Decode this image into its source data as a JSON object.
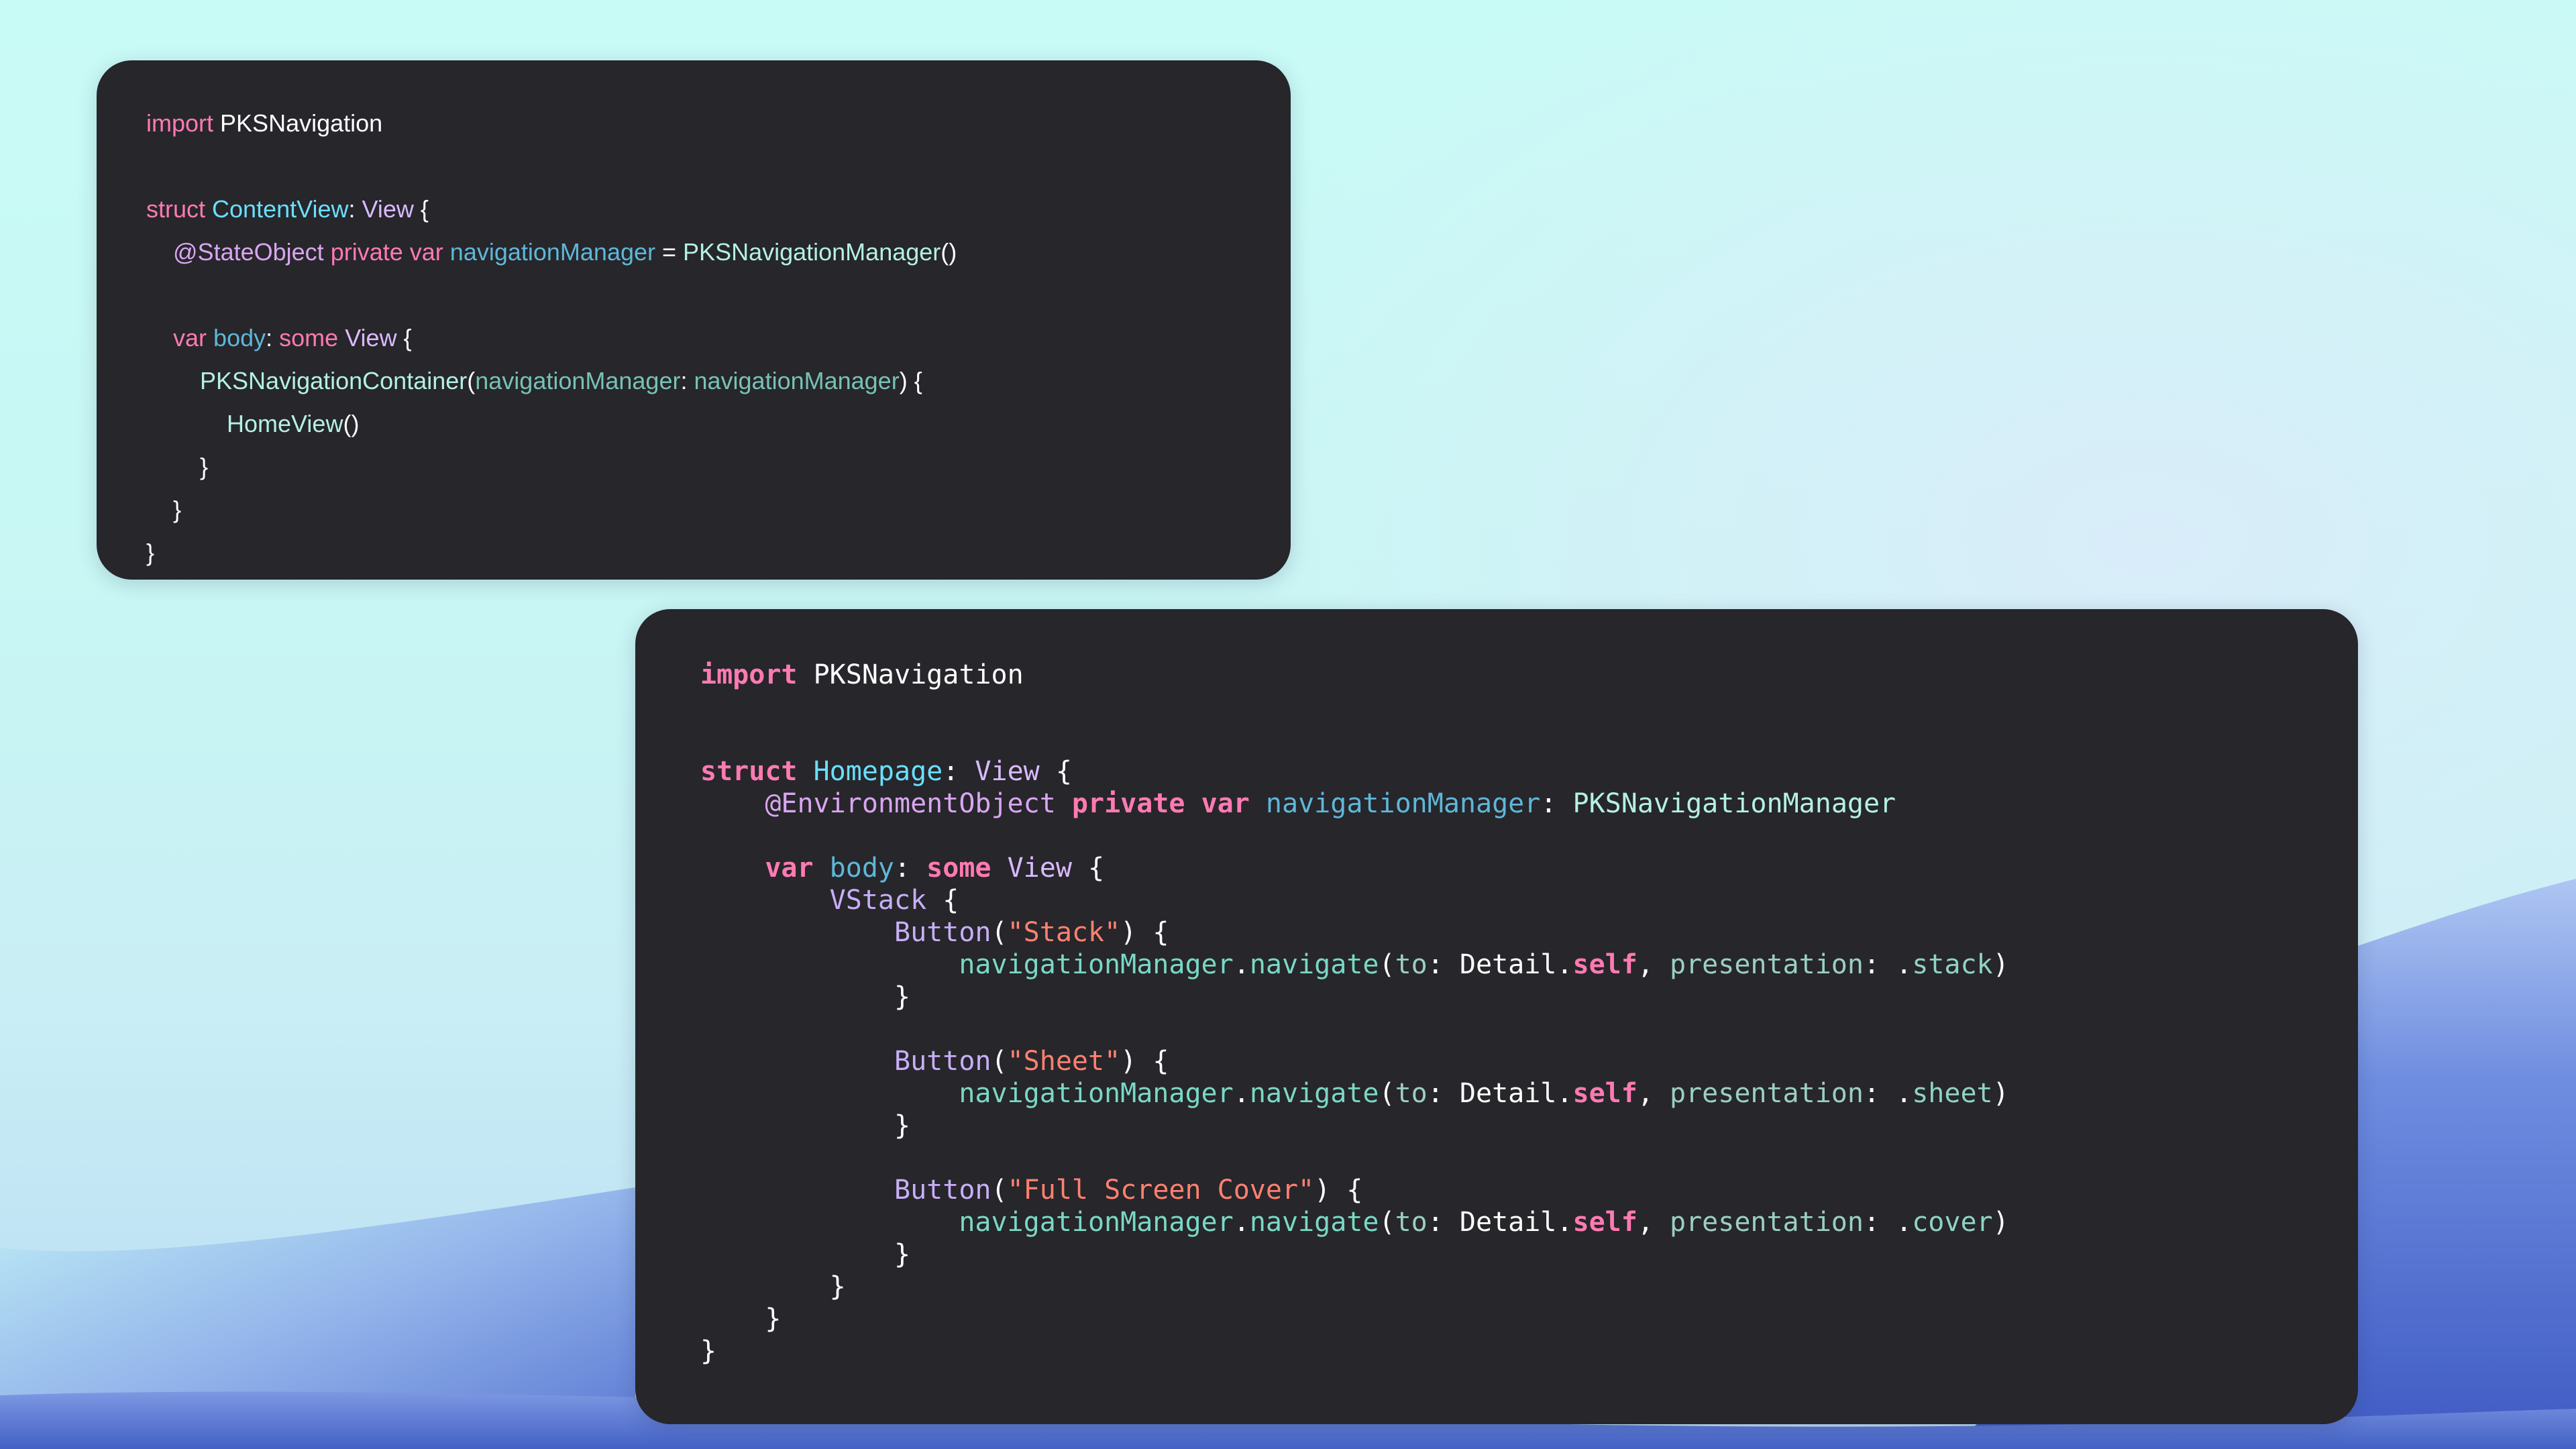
{
  "colors": {
    "card_background": "#26262b",
    "keyword": "#ff7ab2",
    "type_declaration": "#6bdfff",
    "type_reference": "#dabaff",
    "string": "#ff8170",
    "property": "#5fb7d8",
    "plain": "#ffffff",
    "background_top": "#c9fbf6",
    "wave_blue": "#4d6ad0"
  },
  "snippets": [
    {
      "lines": [
        [
          {
            "k": "keyword",
            "t": "import"
          },
          {
            "k": "plain",
            "t": " PKSNavigation"
          }
        ],
        [],
        [
          {
            "k": "keyword",
            "t": "struct"
          },
          {
            "k": "plain",
            "t": " "
          },
          {
            "k": "type",
            "t": "ContentView"
          },
          {
            "k": "plain",
            "t": ": "
          },
          {
            "k": "typeref",
            "t": "View"
          },
          {
            "k": "plain",
            "t": " {"
          }
        ],
        [
          {
            "k": "plain",
            "t": "    "
          },
          {
            "k": "attr",
            "t": "@StateObject"
          },
          {
            "k": "plain",
            "t": " "
          },
          {
            "k": "keyword",
            "t": "private"
          },
          {
            "k": "plain",
            "t": " "
          },
          {
            "k": "keyword",
            "t": "var"
          },
          {
            "k": "plain",
            "t": " "
          },
          {
            "k": "prop",
            "t": "navigationManager"
          },
          {
            "k": "plain",
            "t": " = "
          },
          {
            "k": "call",
            "t": "PKSNavigationManager"
          },
          {
            "k": "plain",
            "t": "()"
          }
        ],
        [],
        [
          {
            "k": "plain",
            "t": "    "
          },
          {
            "k": "keyword",
            "t": "var"
          },
          {
            "k": "plain",
            "t": " "
          },
          {
            "k": "prop",
            "t": "body"
          },
          {
            "k": "plain",
            "t": ": "
          },
          {
            "k": "keyword",
            "t": "some"
          },
          {
            "k": "plain",
            "t": " "
          },
          {
            "k": "typeref",
            "t": "View"
          },
          {
            "k": "plain",
            "t": " {"
          }
        ],
        [
          {
            "k": "plain",
            "t": "        "
          },
          {
            "k": "call",
            "t": "PKSNavigationContainer"
          },
          {
            "k": "plain",
            "t": "("
          },
          {
            "k": "arg",
            "t": "navigationManager"
          },
          {
            "k": "plain",
            "t": ": "
          },
          {
            "k": "arg",
            "t": "navigationManager"
          },
          {
            "k": "plain",
            "t": ") {"
          }
        ],
        [
          {
            "k": "plain",
            "t": "            "
          },
          {
            "k": "call",
            "t": "HomeView"
          },
          {
            "k": "plain",
            "t": "()"
          }
        ],
        [
          {
            "k": "plain",
            "t": "        }"
          }
        ],
        [
          {
            "k": "plain",
            "t": "    }"
          }
        ],
        [
          {
            "k": "plain",
            "t": "}"
          }
        ]
      ]
    },
    {
      "lines": [
        [
          {
            "k": "keyword",
            "t": "import"
          },
          {
            "k": "plain",
            "t": " PKSNavigation"
          }
        ],
        [],
        [],
        [
          {
            "k": "keyword",
            "t": "struct"
          },
          {
            "k": "plain",
            "t": " "
          },
          {
            "k": "type",
            "t": "Homepage"
          },
          {
            "k": "plain",
            "t": ": "
          },
          {
            "k": "typeref",
            "t": "View"
          },
          {
            "k": "plain",
            "t": " {"
          }
        ],
        [
          {
            "k": "plain",
            "t": "    "
          },
          {
            "k": "attr",
            "t": "@EnvironmentObject"
          },
          {
            "k": "plain",
            "t": " "
          },
          {
            "k": "keyword",
            "t": "private"
          },
          {
            "k": "plain",
            "t": " "
          },
          {
            "k": "keyword",
            "t": "var"
          },
          {
            "k": "plain",
            "t": " "
          },
          {
            "k": "prop",
            "t": "navigationManager"
          },
          {
            "k": "plain",
            "t": ": "
          },
          {
            "k": "call",
            "t": "PKSNavigationManager"
          }
        ],
        [],
        [
          {
            "k": "plain",
            "t": "    "
          },
          {
            "k": "keyword",
            "t": "var"
          },
          {
            "k": "plain",
            "t": " "
          },
          {
            "k": "prop",
            "t": "body"
          },
          {
            "k": "plain",
            "t": ": "
          },
          {
            "k": "keyword",
            "t": "some"
          },
          {
            "k": "plain",
            "t": " "
          },
          {
            "k": "typeref",
            "t": "View"
          },
          {
            "k": "plain",
            "t": " {"
          }
        ],
        [
          {
            "k": "plain",
            "t": "        "
          },
          {
            "k": "func",
            "t": "VStack"
          },
          {
            "k": "plain",
            "t": " {"
          }
        ],
        [
          {
            "k": "plain",
            "t": "            "
          },
          {
            "k": "func",
            "t": "Button"
          },
          {
            "k": "plain",
            "t": "("
          },
          {
            "k": "string",
            "t": "\"Stack\""
          },
          {
            "k": "plain",
            "t": ") {"
          }
        ],
        [
          {
            "k": "plain",
            "t": "                "
          },
          {
            "k": "method",
            "t": "navigationManager"
          },
          {
            "k": "plain",
            "t": "."
          },
          {
            "k": "method",
            "t": "navigate"
          },
          {
            "k": "plain",
            "t": "("
          },
          {
            "k": "label",
            "t": "to"
          },
          {
            "k": "plain",
            "t": ": Detail."
          },
          {
            "k": "keyword",
            "t": "self"
          },
          {
            "k": "plain",
            "t": ", "
          },
          {
            "k": "label",
            "t": "presentation"
          },
          {
            "k": "plain",
            "t": ": ."
          },
          {
            "k": "case",
            "t": "stack"
          },
          {
            "k": "plain",
            "t": ")"
          }
        ],
        [
          {
            "k": "plain",
            "t": "            }"
          }
        ],
        [],
        [
          {
            "k": "plain",
            "t": "            "
          },
          {
            "k": "func",
            "t": "Button"
          },
          {
            "k": "plain",
            "t": "("
          },
          {
            "k": "string",
            "t": "\"Sheet\""
          },
          {
            "k": "plain",
            "t": ") {"
          }
        ],
        [
          {
            "k": "plain",
            "t": "                "
          },
          {
            "k": "method",
            "t": "navigationManager"
          },
          {
            "k": "plain",
            "t": "."
          },
          {
            "k": "method",
            "t": "navigate"
          },
          {
            "k": "plain",
            "t": "("
          },
          {
            "k": "label",
            "t": "to"
          },
          {
            "k": "plain",
            "t": ": Detail."
          },
          {
            "k": "keyword",
            "t": "self"
          },
          {
            "k": "plain",
            "t": ", "
          },
          {
            "k": "label",
            "t": "presentation"
          },
          {
            "k": "plain",
            "t": ": ."
          },
          {
            "k": "case",
            "t": "sheet"
          },
          {
            "k": "plain",
            "t": ")"
          }
        ],
        [
          {
            "k": "plain",
            "t": "            }"
          }
        ],
        [],
        [
          {
            "k": "plain",
            "t": "            "
          },
          {
            "k": "func",
            "t": "Button"
          },
          {
            "k": "plain",
            "t": "("
          },
          {
            "k": "string",
            "t": "\"Full Screen Cover\""
          },
          {
            "k": "plain",
            "t": ") {"
          }
        ],
        [
          {
            "k": "plain",
            "t": "                "
          },
          {
            "k": "method",
            "t": "navigationManager"
          },
          {
            "k": "plain",
            "t": "."
          },
          {
            "k": "method",
            "t": "navigate"
          },
          {
            "k": "plain",
            "t": "("
          },
          {
            "k": "label",
            "t": "to"
          },
          {
            "k": "plain",
            "t": ": Detail."
          },
          {
            "k": "keyword",
            "t": "self"
          },
          {
            "k": "plain",
            "t": ", "
          },
          {
            "k": "label",
            "t": "presentation"
          },
          {
            "k": "plain",
            "t": ": ."
          },
          {
            "k": "case",
            "t": "cover"
          },
          {
            "k": "plain",
            "t": ")"
          }
        ],
        [
          {
            "k": "plain",
            "t": "            }"
          }
        ],
        [
          {
            "k": "plain",
            "t": "        }"
          }
        ],
        [
          {
            "k": "plain",
            "t": "    }"
          }
        ],
        [
          {
            "k": "plain",
            "t": "}"
          }
        ]
      ]
    }
  ]
}
